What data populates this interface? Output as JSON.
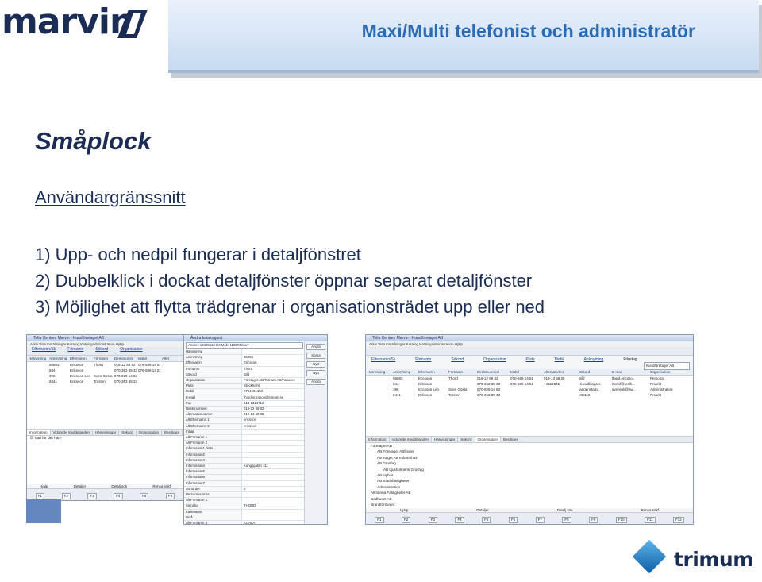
{
  "logo": {
    "text": "marvin",
    "color": "#1b2d54"
  },
  "banner": {
    "title": "Maxi/Multi telefonist och administratör",
    "title_color": "#2b6bb5"
  },
  "heading": "Småplock",
  "subheading": "Användargränssnitt",
  "list": [
    "1)  Upp- och nedpil fungerar i detaljfönstret",
    "2)  Dubbelklick i dockat detaljfönster öppnar separat detaljfönster",
    "3)  Möjlighet att flytta trädgrenar i organisationsträdet upp eller ned"
  ],
  "screenshot1": {
    "title": "Telia Centrex Marvin - Kundföretaget AB",
    "menu": "Arkiv   Visa   Inställningar   Katalog   Katalogadministration   Hjälp",
    "search_links": [
      "Efternamn/Sk",
      "Förnamn",
      "Sökord",
      "Organisation"
    ],
    "columns": [
      "Hänvisning",
      "Anknytning",
      "Efternamn",
      "Förnamn",
      "Direktnumm",
      "Mobil",
      "Alter"
    ],
    "rows": [
      [
        "",
        "95883",
        "Ericsson",
        "Thord",
        "018-12 59 82",
        "076-589 14 51",
        ""
      ],
      [
        "",
        "844",
        "Eriksson",
        "",
        "070-363 85 33",
        "076-589 14 51",
        ""
      ],
      [
        "",
        "396",
        "Ericsson Len",
        "Sven Gösta",
        "070-929 14 53",
        "",
        ""
      ],
      [
        "",
        "8441",
        "Eriksson",
        "Torsten",
        "070-363 85 33",
        "",
        ""
      ]
    ],
    "tabs": [
      "Information",
      "Vidarede meddelanden",
      "Hänvisningar",
      "Sökord",
      "Organisation",
      "Besökare"
    ],
    "message": "Vad för det här?",
    "flabels": [
      "Hjälp",
      "Detaljer",
      "Detalj sök",
      "Rensa sökf"
    ],
    "fkeys": [
      "F1",
      "F2",
      "F3",
      "F4",
      "F5",
      "F6"
    ]
  },
  "screenshot2": {
    "title": "Ändra katalogpost",
    "dropdown": "Anders 12345612 R4 Mob: 1123RD/no7",
    "side_buttons": [
      "Ändra",
      "Spara",
      "Nytt",
      "Nytt",
      "Ändra"
    ],
    "fields": [
      [
        "Hänvisning",
        ""
      ],
      [
        "Anknytning",
        "95083"
      ],
      [
        "Efternamn",
        "Ericsson"
      ],
      [
        "Förnamn",
        "Thord"
      ],
      [
        "Sökord",
        "Bild"
      ],
      [
        "Organisation",
        "Företaget AB/Tornum AB/Fanosec"
      ],
      [
        "Plats",
        "Stockholm"
      ],
      [
        "Mobil",
        "0764261453"
      ],
      [
        "E-mail",
        "thord.ericsson@trimum.se"
      ],
      [
        "Fax",
        "018-1314712"
      ],
      [
        "Direktnummer",
        "018-12 59 82"
      ],
      [
        "Alternativnummer",
        "018-13 58 35"
      ],
      [
        "Alt Efternamn 1",
        "ericsson"
      ],
      [
        "Alt Efternamn 2",
        "eriksson"
      ],
      [
        "Initial",
        ""
      ],
      [
        "Alt Förnamn 1",
        ""
      ],
      [
        "Alt Förnamn 2",
        ""
      ],
      [
        "Information1 plats",
        ""
      ],
      [
        "Information2",
        ""
      ],
      [
        "Information3",
        ""
      ],
      [
        "Information4",
        "Kungsgatan 111"
      ],
      [
        "Information5",
        ""
      ],
      [
        "Information6",
        ""
      ],
      [
        "Information7",
        ""
      ],
      [
        "Sortorder",
        "0"
      ],
      [
        "Personnummer",
        ""
      ],
      [
        "Alt Förnamn 3",
        ""
      ],
      [
        "Signatur",
        "THORD"
      ],
      [
        "Kallenamn",
        ""
      ],
      [
        "Nivå",
        ""
      ],
      [
        "Alt Förnamn 4",
        "KOALA"
      ]
    ]
  },
  "screenshot3": {
    "title": "Telia Centrex Marvin - Kundföretaget AB",
    "menu": "Arkiv   Visa   Inställningar   Katalog   Katalogadministration   Hjälp",
    "search_links": [
      "Efternamn/Sk",
      "Förnamn",
      "Sökord",
      "Organisation",
      "Plats",
      "Mobil",
      "Anknytning"
    ],
    "company_label": "Företag",
    "company_value": "Kundföretaget AB",
    "columns": [
      "Hänvisning",
      "Anknytning",
      "Efternamn",
      "Förnamn",
      "Direktnummer",
      "Mobil",
      "Alternativt nu",
      "Sökord",
      "E-mail",
      "Organisation"
    ],
    "rows": [
      [
        "",
        "95883",
        "Ericsson",
        "Thord",
        "018-12 59 82",
        "070-589 14 51",
        "018-13 58 35",
        "Bild",
        "thord.ericsso...",
        "Personal"
      ],
      [
        "",
        "844",
        "Eriksson",
        "",
        "070-363 85 33",
        "070-589 14 51",
        "+4612345",
        "Huvudlitagare",
        "borlof@teslk...",
        "Projekt"
      ],
      [
        "",
        "396",
        "Ericsson Len",
        "Sven Gösta",
        "070-929 14 53",
        "",
        "",
        "tangenstarto",
        "svenesk@sw...",
        "Administration"
      ],
      [
        "",
        "8441",
        "Eriksson",
        "Torsten",
        "070-363 85 33",
        "",
        "",
        "MC110",
        "",
        "Projekt"
      ]
    ],
    "tabs": [
      "Information",
      "Vidarede meddelanden",
      "Hänvisningar",
      "Sökord",
      "Organisation",
      "Besökare"
    ],
    "tree": [
      "Företaget AB",
      "AB Företaget ABfinans",
      "Företaget AB Industrihus",
      "AB Grusfag",
      "AB Ljusholmens Grusfag",
      "AB Hybus",
      "AB Stadsfastigheter",
      "Administration",
      "Allmänna Fastigheter AB",
      "Badhuset AB",
      "Brandförsvaret"
    ],
    "flabels": [
      "Hjälp",
      "Detaljer",
      "Detalj sök",
      "Rensa sökf"
    ],
    "fkeys": [
      "F1",
      "F2",
      "F3",
      "F4",
      "F5",
      "F6",
      "F7",
      "F8",
      "F9",
      "F10",
      "F11",
      "F12"
    ]
  },
  "trimum": {
    "text": "trimum"
  }
}
